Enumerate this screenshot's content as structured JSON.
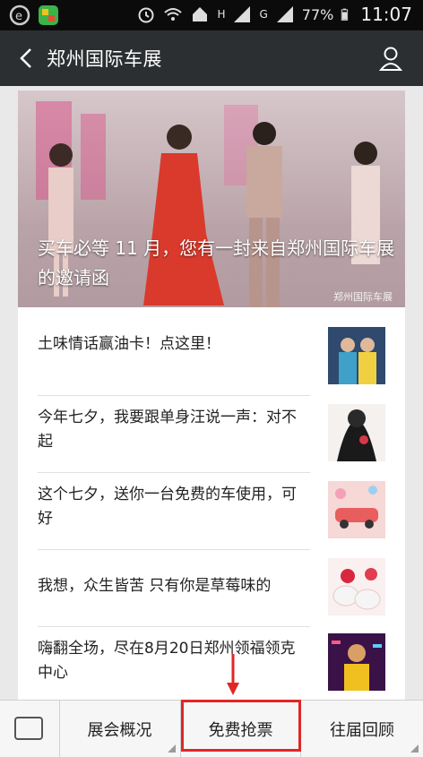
{
  "statusbar": {
    "signal1": "H",
    "signal2": "G",
    "battery": "77%",
    "time": "11:07"
  },
  "header": {
    "title": "郑州国际车展"
  },
  "hero": {
    "caption": "买车必等 11 月，您有一封来自郑州国际车展的邀请函",
    "watermark": "郑州国际车展"
  },
  "articles": [
    {
      "title": "土味情话赢油卡！点这里！"
    },
    {
      "title": "今年七夕，我要跟单身汪说一声：对不起"
    },
    {
      "title": "这个七夕，送你一台免费的车使用，可好"
    },
    {
      "title": "我想，众生皆苦 只有你是草莓味的"
    },
    {
      "title": "嗨翻全场，尽在8月20日郑州领福领克中心"
    }
  ],
  "bottom_menu": {
    "item1": "展会概况",
    "item2": "免费抢票",
    "item3": "往届回顾"
  },
  "colors": {
    "titlebar": "#2b2f31",
    "highlight": "#e02727"
  }
}
